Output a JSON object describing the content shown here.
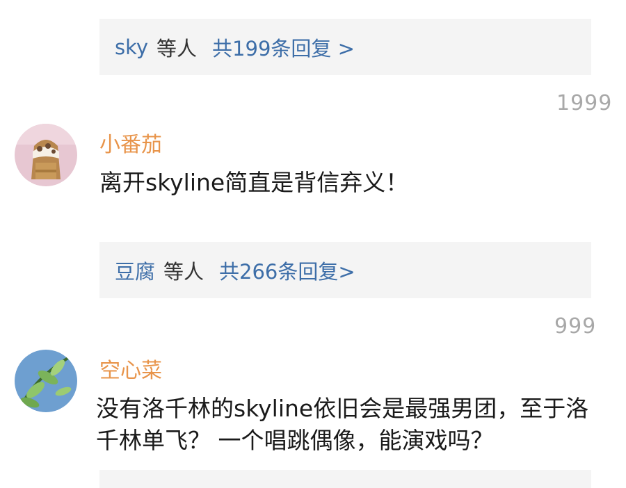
{
  "thread1": {
    "reply_preview": {
      "name": "sky",
      "others": "等人",
      "count": "共199条回复 >"
    },
    "likes": "1999"
  },
  "comment1": {
    "username": "小番茄",
    "text": "离开skyline简直是背信弃义！",
    "reply_preview": {
      "name": "豆腐",
      "others": "等人",
      "count": "共266条回复>"
    },
    "likes": "999"
  },
  "comment2": {
    "username": "空心菜",
    "text": "没有洛千林的skyline依旧会是最强男团，至于洛千林单飞？ 一个唱跳偶像，能演戏吗？"
  },
  "colors": {
    "username": "#e8944a",
    "reply_link": "#3d6ea8",
    "reply_bg": "#f4f4f4",
    "likes": "#a8a8a8"
  }
}
